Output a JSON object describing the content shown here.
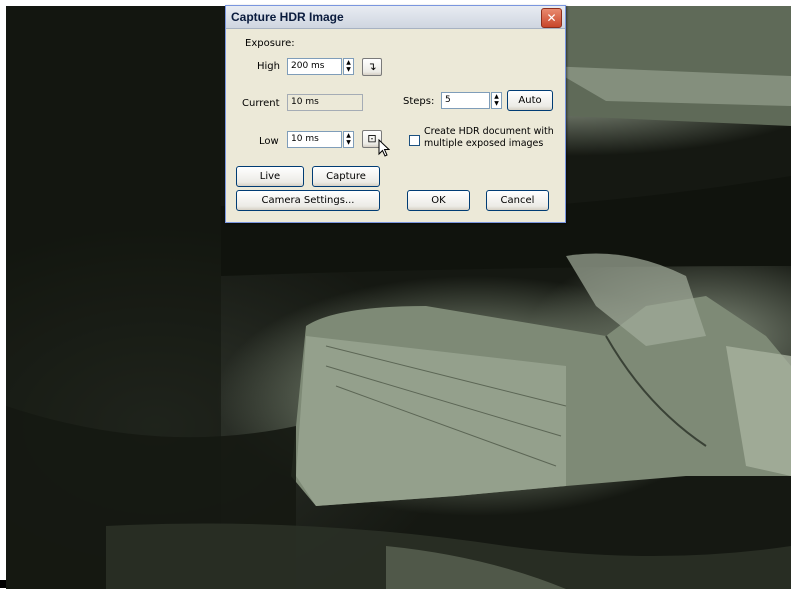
{
  "dialog": {
    "title": "Capture HDR Image",
    "close_glyph": "✕",
    "exposure_label": "Exposure:",
    "high": {
      "label": "High",
      "value": "200 ms"
    },
    "current": {
      "label": "Current",
      "value": "10 ms"
    },
    "low": {
      "label": "Low",
      "value": "10 ms"
    },
    "steps": {
      "label": "Steps:",
      "value": "5",
      "auto_button": "Auto"
    },
    "hdr_checkbox": {
      "label_line1": "Create HDR document with",
      "label_line2": "multiple exposed images",
      "checked": false
    },
    "buttons": {
      "live": "Live",
      "capture": "Capture",
      "camera_settings": "Camera Settings...",
      "ok": "OK",
      "cancel": "Cancel"
    },
    "icons": {
      "set_high": "arrow-down-right-icon",
      "set_low": "frame-select-icon"
    }
  },
  "colors": {
    "dialog_bg": "#ece9d8",
    "close_button": "#c8462b",
    "button_border": "#003c74"
  }
}
